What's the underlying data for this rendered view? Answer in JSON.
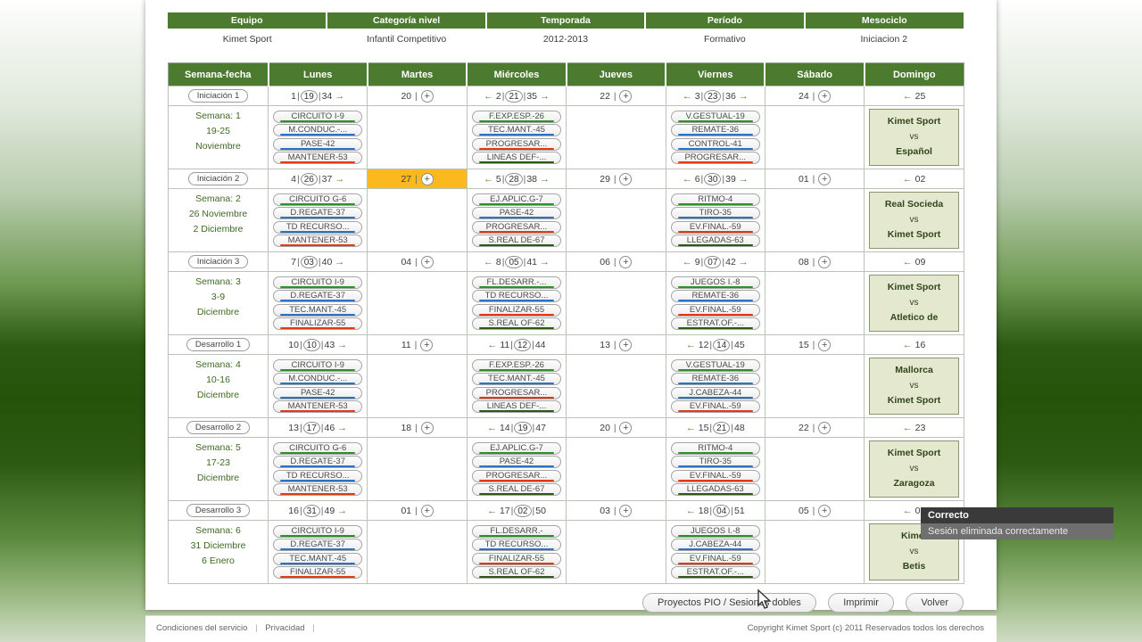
{
  "info": {
    "headers": [
      "Equipo",
      "Categoría nivel",
      "Temporada",
      "Período",
      "Mesociclo"
    ],
    "values": [
      "Kimet Sport",
      "Infantil Competitivo",
      "2012-2013",
      "Formativo",
      "Iniciacion 2"
    ]
  },
  "grid": {
    "columns": [
      "Semana-fecha",
      "Lunes",
      "Martes",
      "Miércoles",
      "Jueves",
      "Viernes",
      "Sábado",
      "Domingo"
    ]
  },
  "weeks": [
    {
      "badge": "Iniciación 1",
      "week_label": "Semana: 1",
      "date_line1": "19-25",
      "date_line2": "Noviembre",
      "nums": [
        {
          "a": "1",
          "b": "19",
          "c": "34",
          "left_arrow": false,
          "right_arrow": true
        },
        {
          "a": "20",
          "plus": true
        },
        {
          "a": "2",
          "b": "21",
          "c": "35",
          "left_arrow": true,
          "right_arrow": true
        },
        {
          "a": "22",
          "plus": true
        },
        {
          "a": "3",
          "b": "23",
          "c": "36",
          "left_arrow": true,
          "right_arrow": true
        },
        {
          "a": "24",
          "plus": true
        },
        {
          "a": "25",
          "left_arrow": true
        }
      ],
      "lunes": [
        {
          "label": "CIRCUITO I-9",
          "color": "green"
        },
        {
          "label": "M.CONDUC.-...",
          "color": "blue"
        },
        {
          "label": "PASE-42",
          "color": "blue"
        },
        {
          "label": "MANTENER-53",
          "color": "red"
        }
      ],
      "martes": [],
      "miercoles": [
        {
          "label": "F.EXP.ESP.-26",
          "color": "green"
        },
        {
          "label": "TEC.MANT.-45",
          "color": "blue"
        },
        {
          "label": "PROGRESAR...",
          "color": "red"
        },
        {
          "label": "LINEAS DEF-...",
          "color": "dgreen"
        }
      ],
      "jueves": [],
      "viernes": [
        {
          "label": "V.GESTUAL-19",
          "color": "green"
        },
        {
          "label": "REMATE-36",
          "color": "blue"
        },
        {
          "label": "CONTROL-41",
          "color": "blue"
        },
        {
          "label": "PROGRESAR...",
          "color": "red"
        }
      ],
      "sabado": [],
      "match": {
        "home": "Kimet Sport",
        "vs": "vs",
        "away": "Español"
      }
    },
    {
      "badge": "Iniciación 2",
      "week_label": "Semana: 2",
      "date_line1": "26 Noviembre",
      "date_line2": "2  Diciembre",
      "nums": [
        {
          "a": "4",
          "b": "26",
          "c": "37",
          "left_arrow": false,
          "right_arrow": true
        },
        {
          "a": "27",
          "plus": true,
          "highlight": true
        },
        {
          "a": "5",
          "b": "28",
          "c": "38",
          "left_arrow": true,
          "right_arrow": true
        },
        {
          "a": "29",
          "plus": true
        },
        {
          "a": "6",
          "b": "30",
          "c": "39",
          "left_arrow": true,
          "right_arrow": true
        },
        {
          "a": "01",
          "plus": true
        },
        {
          "a": "02",
          "left_arrow": true
        }
      ],
      "lunes": [
        {
          "label": "CIRCUITO G-6",
          "color": "green"
        },
        {
          "label": "D.REGATE-37",
          "color": "blue"
        },
        {
          "label": "TD RECURSO...",
          "color": "blue"
        },
        {
          "label": "MANTENER-53",
          "color": "red"
        }
      ],
      "martes": [],
      "miercoles": [
        {
          "label": "EJ.APLIC.G-7",
          "color": "green"
        },
        {
          "label": "PASE-42",
          "color": "blue"
        },
        {
          "label": "PROGRESAR...",
          "color": "red"
        },
        {
          "label": "S.REAL DE-67",
          "color": "dgreen"
        }
      ],
      "jueves": [],
      "viernes": [
        {
          "label": "RITMO-4",
          "color": "green"
        },
        {
          "label": "TIRO-35",
          "color": "blue"
        },
        {
          "label": "EV.FINAL.-59",
          "color": "red"
        },
        {
          "label": "LLEGADAS-63",
          "color": "dgreen"
        }
      ],
      "sabado": [],
      "match": {
        "home": "Real Socieda",
        "vs": "vs",
        "away": "Kimet Sport"
      }
    },
    {
      "badge": "Iniciación 3",
      "week_label": "Semana: 3",
      "date_line1": "3-9",
      "date_line2": "Diciembre",
      "nums": [
        {
          "a": "7",
          "b": "03",
          "c": "40",
          "left_arrow": false,
          "right_arrow": true
        },
        {
          "a": "04",
          "plus": true
        },
        {
          "a": "8",
          "b": "05",
          "c": "41",
          "left_arrow": true,
          "right_arrow": true
        },
        {
          "a": "06",
          "plus": true
        },
        {
          "a": "9",
          "b": "07",
          "c": "42",
          "left_arrow": true,
          "right_arrow": true
        },
        {
          "a": "08",
          "plus": true
        },
        {
          "a": "09",
          "left_arrow": true
        }
      ],
      "lunes": [
        {
          "label": "CIRCUITO I-9",
          "color": "green"
        },
        {
          "label": "D.REGATE-37",
          "color": "blue"
        },
        {
          "label": "TEC.MANT.-45",
          "color": "blue"
        },
        {
          "label": "FINALIZAR-55",
          "color": "red"
        }
      ],
      "martes": [],
      "miercoles": [
        {
          "label": "FL.DESARR.-...",
          "color": "green"
        },
        {
          "label": "TD RECURSO...",
          "color": "blue"
        },
        {
          "label": "FINALIZAR-55",
          "color": "red"
        },
        {
          "label": "S.REAL OF-62",
          "color": "dgreen"
        }
      ],
      "jueves": [],
      "viernes": [
        {
          "label": "JUEGOS I.-8",
          "color": "green"
        },
        {
          "label": "REMATE-36",
          "color": "blue"
        },
        {
          "label": "EV.FINAL.-59",
          "color": "red"
        },
        {
          "label": "ESTRAT.OF.-...",
          "color": "dgreen"
        }
      ],
      "sabado": [],
      "match": {
        "home": "Kimet Sport",
        "vs": "vs",
        "away": "Atletico de"
      }
    },
    {
      "badge": "Desarrollo 1",
      "week_label": "Semana: 4",
      "date_line1": "10-16",
      "date_line2": "Diciembre",
      "nums": [
        {
          "a": "10",
          "b": "10",
          "c": "43",
          "left_arrow": false,
          "right_arrow": true
        },
        {
          "a": "11",
          "plus": true
        },
        {
          "a": "11",
          "b": "12",
          "c": "44",
          "left_arrow": true,
          "right_arrow": false
        },
        {
          "a": "13",
          "plus": true
        },
        {
          "a": "12",
          "b": "14",
          "c": "45",
          "left_arrow": true,
          "right_arrow": false
        },
        {
          "a": "15",
          "plus": true
        },
        {
          "a": "16",
          "left_arrow": true
        }
      ],
      "lunes": [
        {
          "label": "CIRCUITO I-9",
          "color": "green"
        },
        {
          "label": "M.CONDUC.-...",
          "color": "blue"
        },
        {
          "label": "PASE-42",
          "color": "blue"
        },
        {
          "label": "MANTENER-53",
          "color": "red"
        }
      ],
      "martes": [],
      "miercoles": [
        {
          "label": "F.EXP.ESP.-26",
          "color": "green"
        },
        {
          "label": "TEC.MANT.-45",
          "color": "blue"
        },
        {
          "label": "PROGRESAR...",
          "color": "red"
        },
        {
          "label": "LINEAS DEF-...",
          "color": "dgreen"
        }
      ],
      "jueves": [],
      "viernes": [
        {
          "label": "V.GESTUAL-19",
          "color": "green"
        },
        {
          "label": "REMATE-36",
          "color": "blue"
        },
        {
          "label": "J.CABEZA-44",
          "color": "blue"
        },
        {
          "label": "EV.FINAL.-59",
          "color": "red"
        }
      ],
      "sabado": [],
      "match": {
        "home": "Mallorca",
        "vs": "vs",
        "away": "Kimet Sport"
      }
    },
    {
      "badge": "Desarrollo 2",
      "week_label": "Semana: 5",
      "date_line1": "17-23",
      "date_line2": "Diciembre",
      "nums": [
        {
          "a": "13",
          "b": "17",
          "c": "46",
          "left_arrow": false,
          "right_arrow": true
        },
        {
          "a": "18",
          "plus": true
        },
        {
          "a": "14",
          "b": "19",
          "c": "47",
          "left_arrow": true,
          "right_arrow": false
        },
        {
          "a": "20",
          "plus": true
        },
        {
          "a": "15",
          "b": "21",
          "c": "48",
          "left_arrow": true,
          "right_arrow": false
        },
        {
          "a": "22",
          "plus": true
        },
        {
          "a": "23",
          "left_arrow": true
        }
      ],
      "lunes": [
        {
          "label": "CIRCUITO G-6",
          "color": "green"
        },
        {
          "label": "D.REGATE-37",
          "color": "blue"
        },
        {
          "label": "TD RECURSO...",
          "color": "blue"
        },
        {
          "label": "MANTENER-53",
          "color": "red"
        }
      ],
      "martes": [],
      "miercoles": [
        {
          "label": "EJ.APLIC.G-7",
          "color": "green"
        },
        {
          "label": "PASE-42",
          "color": "blue"
        },
        {
          "label": "PROGRESAR...",
          "color": "red"
        },
        {
          "label": "S.REAL DE-67",
          "color": "dgreen"
        }
      ],
      "jueves": [],
      "viernes": [
        {
          "label": "RITMO-4",
          "color": "green"
        },
        {
          "label": "TIRO-35",
          "color": "blue"
        },
        {
          "label": "EV.FINAL.-59",
          "color": "red"
        },
        {
          "label": "LLEGADAS-63",
          "color": "dgreen"
        }
      ],
      "sabado": [],
      "match": {
        "home": "Kimet Sport",
        "vs": "vs",
        "away": "Zaragoza"
      }
    },
    {
      "badge": "Desarrollo 3",
      "week_label": "Semana: 6",
      "date_line1": "31 Diciembre",
      "date_line2": "6  Enero",
      "nums": [
        {
          "a": "16",
          "b": "31",
          "c": "49",
          "left_arrow": false,
          "right_arrow": true
        },
        {
          "a": "01",
          "plus": true
        },
        {
          "a": "17",
          "b": "02",
          "c": "50",
          "left_arrow": true,
          "right_arrow": false
        },
        {
          "a": "03",
          "plus": true
        },
        {
          "a": "18",
          "b": "04",
          "c": "51",
          "left_arrow": true,
          "right_arrow": false
        },
        {
          "a": "05",
          "plus": true
        },
        {
          "a": "06",
          "left_arrow": true
        }
      ],
      "lunes": [
        {
          "label": "CIRCUITO I-9",
          "color": "green"
        },
        {
          "label": "D.REGATE-37",
          "color": "blue"
        },
        {
          "label": "TEC.MANT.-45",
          "color": "blue"
        },
        {
          "label": "FINALIZAR-55",
          "color": "red"
        }
      ],
      "martes": [],
      "miercoles": [
        {
          "label": "FL.DESARR.-",
          "color": "green"
        },
        {
          "label": "TD RECURSO...",
          "color": "blue"
        },
        {
          "label": "FINALIZAR-55",
          "color": "red"
        },
        {
          "label": "S.REAL OF-62",
          "color": "dgreen"
        }
      ],
      "jueves": [],
      "viernes": [
        {
          "label": "JUEGOS I.-8",
          "color": "green"
        },
        {
          "label": "J.CABEZA-44",
          "color": "blue"
        },
        {
          "label": "EV.FINAL.-59",
          "color": "red"
        },
        {
          "label": "ESTRAT.OF.-...",
          "color": "dgreen"
        }
      ],
      "sabado": [],
      "match": {
        "home": "Kimet",
        "vs": "vs",
        "away": "Betis"
      }
    }
  ],
  "buttons": {
    "proyectos": "Proyectos PIO / Sesiones dobles",
    "imprimir": "Imprimir",
    "volver": "Volver"
  },
  "toast": {
    "title": "Correcto",
    "message": "Sesión eliminada correctamente"
  },
  "footer": {
    "terms": "Condiciones del servicio",
    "privacy": "Privacidad",
    "copyright": "Copyright Kimet Sport (c) 2011 Reservados todos los derechos"
  },
  "colors": {
    "header_green": "#4c7a2e",
    "highlight_orange": "#fbb91f",
    "match_bg": "#e4e8cf",
    "underline_green": "#2f8f2a",
    "underline_blue": "#2f72c4",
    "underline_red": "#e03a16",
    "underline_dgreen": "#2c5a13"
  }
}
